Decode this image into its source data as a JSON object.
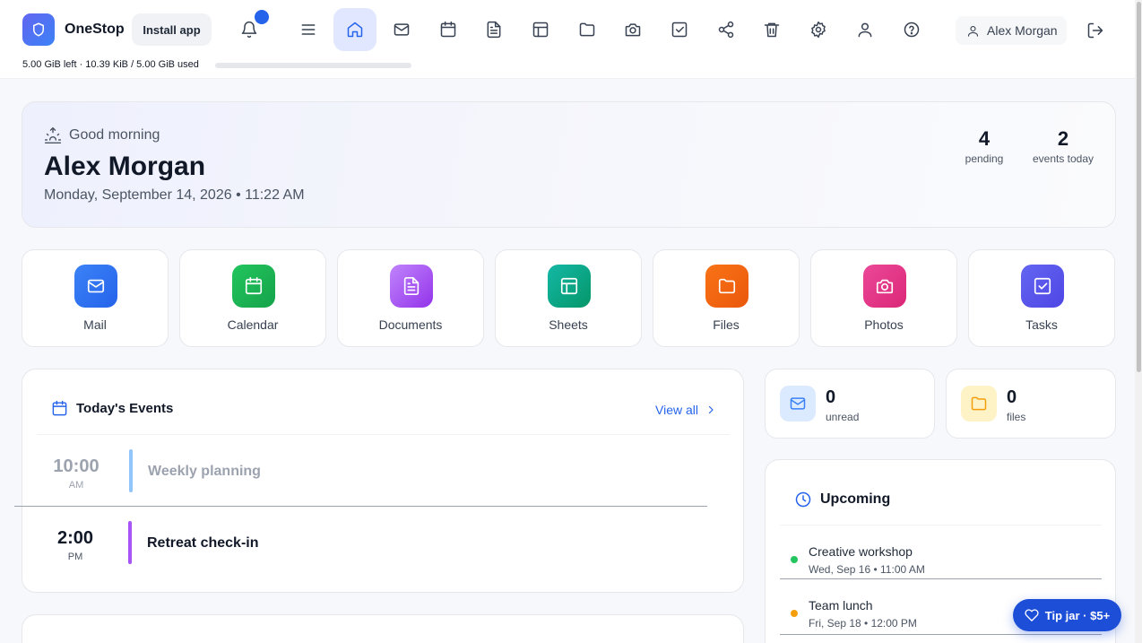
{
  "header": {
    "brand": "OneStop",
    "install_label": "Install app",
    "user_name": "Alex Morgan",
    "storage_text": "5.00 GiB left · 10.39 KiB / 5.00 GiB used",
    "storage_used_fraction": 2e-06,
    "nav_icons": [
      "menu-icon",
      "home-icon",
      "mail-icon",
      "calendar-icon",
      "document-icon",
      "sheets-icon",
      "folder-icon",
      "camera-icon",
      "tasks-icon",
      "share-icon",
      "trash-icon",
      "gear-icon",
      "user-icon",
      "help-icon"
    ],
    "active_nav": "home-icon"
  },
  "greeting": {
    "salutation": "Good morning",
    "name": "Alex Morgan",
    "datetime": "Monday, September 14, 2026 • 11:22 AM",
    "stats": [
      {
        "value": "4",
        "label": "pending"
      },
      {
        "value": "2",
        "label": "events today"
      }
    ]
  },
  "apps": [
    {
      "label": "Mail",
      "icon": "mail-icon",
      "color": "#3b82f6"
    },
    {
      "label": "Calendar",
      "icon": "calendar-icon",
      "color": "#16a34a"
    },
    {
      "label": "Documents",
      "icon": "document-icon",
      "color": "#a855f7"
    },
    {
      "label": "Sheets",
      "icon": "sheets-icon",
      "color": "#10b981"
    },
    {
      "label": "Files",
      "icon": "folder-icon",
      "color": "#f97316"
    },
    {
      "label": "Photos",
      "icon": "camera-icon",
      "color": "#e11d74"
    },
    {
      "label": "Tasks",
      "icon": "tasks-icon",
      "color": "#4f46e5"
    }
  ],
  "events": {
    "title": "Today's Events",
    "view_all": "View all",
    "items": [
      {
        "time": "10:00",
        "ampm": "AM",
        "title": "Weekly planning",
        "past": true,
        "bar_color": "#93c5fd"
      },
      {
        "time": "2:00",
        "ampm": "PM",
        "title": "Retreat check-in",
        "past": false,
        "bar_color": "#a855f7"
      }
    ]
  },
  "mini_stats": [
    {
      "value": "0",
      "label": "unread",
      "icon": "mail-icon",
      "color": "#3b82f6"
    },
    {
      "value": "0",
      "label": "files",
      "icon": "folder-icon",
      "color": "#f59e0b"
    }
  ],
  "upcoming": {
    "title": "Upcoming",
    "items": [
      {
        "title": "Creative workshop",
        "when": "Wed, Sep 16 • 11:00 AM",
        "dot": "#22c55e"
      },
      {
        "title": "Team lunch",
        "when": "Fri, Sep 18 • 12:00 PM",
        "dot": "#f59e0b"
      }
    ]
  },
  "tip_jar": {
    "label": "Tip jar · $5+"
  },
  "colors": {
    "accent": "#2563eb",
    "active_nav_bg": "#e0e7ff"
  }
}
